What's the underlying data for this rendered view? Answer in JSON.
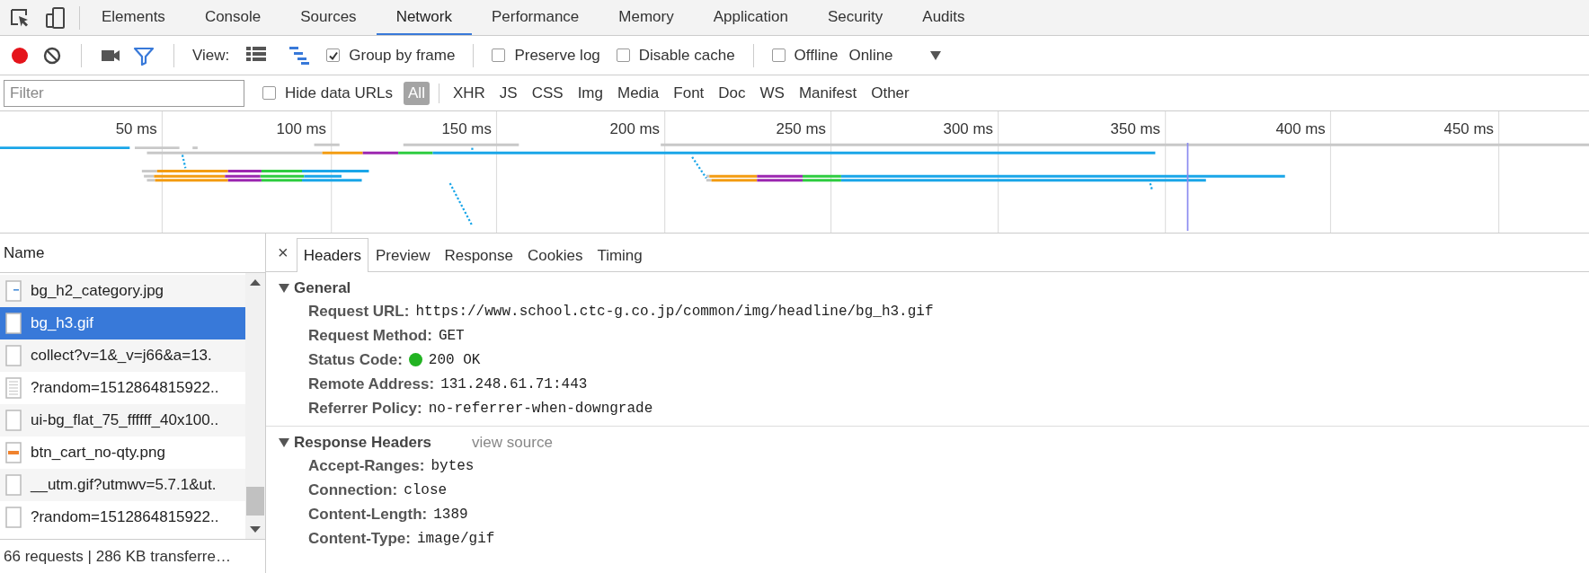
{
  "main_tabs": [
    {
      "label": "Elements",
      "selected": false
    },
    {
      "label": "Console",
      "selected": false
    },
    {
      "label": "Sources",
      "selected": false
    },
    {
      "label": "Network",
      "selected": true
    },
    {
      "label": "Performance",
      "selected": false
    },
    {
      "label": "Memory",
      "selected": false
    },
    {
      "label": "Application",
      "selected": false
    },
    {
      "label": "Security",
      "selected": false
    },
    {
      "label": "Audits",
      "selected": false
    }
  ],
  "toolbar": {
    "record_on": true,
    "filter_active": true,
    "view_label": "View:",
    "view_modes": [
      {
        "kind": "list",
        "selected": false
      },
      {
        "kind": "waterfall",
        "selected": true
      }
    ],
    "checkbox_groups": [
      [
        {
          "label": "Group by frame",
          "checked": true
        }
      ],
      [
        {
          "label": "Preserve log",
          "checked": false
        },
        {
          "label": "Disable cache",
          "checked": false
        }
      ],
      [
        {
          "label": "Offline",
          "checked": false
        }
      ]
    ],
    "throttling": "Online"
  },
  "filter_bar": {
    "placeholder": "Filter",
    "hide_data_urls": {
      "label": "Hide data URLs",
      "checked": false
    },
    "types": [
      {
        "label": "All",
        "selected": true
      },
      {
        "label": "XHR",
        "selected": false
      },
      {
        "label": "JS",
        "selected": false
      },
      {
        "label": "CSS",
        "selected": false
      },
      {
        "label": "Img",
        "selected": false
      },
      {
        "label": "Media",
        "selected": false
      },
      {
        "label": "Font",
        "selected": false
      },
      {
        "label": "Doc",
        "selected": false
      },
      {
        "label": "WS",
        "selected": false
      },
      {
        "label": "Manifest",
        "selected": false
      },
      {
        "label": "Other",
        "selected": false
      }
    ]
  },
  "overview": {
    "ticks": [
      "50 ms",
      "100 ms",
      "150 ms",
      "200 ms",
      "250 ms",
      "300 ms",
      "350 ms",
      "400 ms",
      "450 ms"
    ]
  },
  "requests": {
    "column": "Name",
    "rows": [
      {
        "name": "bg_h2_category.jpg",
        "kind": "image",
        "color": "#4a8fd8",
        "selected": false
      },
      {
        "name": "bg_h3.gif",
        "kind": "blank",
        "selected": true
      },
      {
        "name": "collect?v=1&_v=j66&a=13.",
        "kind": "blank",
        "selected": false
      },
      {
        "name": "?random=1512864815922..",
        "kind": "document",
        "selected": false
      },
      {
        "name": "ui-bg_flat_75_ffffff_40x100..",
        "kind": "blank",
        "selected": false
      },
      {
        "name": "btn_cart_no-qty.png",
        "kind": "image",
        "color": "#f0822d",
        "selected": false
      },
      {
        "name": "__utm.gif?utmwv=5.7.1&ut.",
        "kind": "blank",
        "selected": false
      },
      {
        "name": "?random=1512864815922..",
        "kind": "blank",
        "selected": false
      }
    ],
    "summary": "66 requests | 286 KB transferre…"
  },
  "details": {
    "close": "×",
    "tabs": [
      {
        "label": "Headers",
        "selected": true
      },
      {
        "label": "Preview",
        "selected": false
      },
      {
        "label": "Response",
        "selected": false
      },
      {
        "label": "Cookies",
        "selected": false
      },
      {
        "label": "Timing",
        "selected": false
      }
    ],
    "sections": [
      {
        "title": "General",
        "expanded": true,
        "fields": [
          {
            "name": "Request URL:",
            "value": "https://www.school.ctc-g.co.jp/common/img/headline/bg_h3.gif"
          },
          {
            "name": "Request Method:",
            "value": "GET"
          },
          {
            "name": "Status Code:",
            "value": "200 OK",
            "color": "#22b322"
          },
          {
            "name": "Remote Address:",
            "value": "131.248.61.71:443"
          },
          {
            "name": "Referrer Policy:",
            "value": "no-referrer-when-downgrade"
          }
        ]
      },
      {
        "title": "Response Headers",
        "expanded": true,
        "link": "view source",
        "fields": [
          {
            "name": "Accept-Ranges:",
            "value": "bytes"
          },
          {
            "name": "Connection:",
            "value": "close"
          },
          {
            "name": "Content-Length:",
            "value": "1389"
          },
          {
            "name": "Content-Type:",
            "value": "image/gif"
          }
        ]
      }
    ]
  }
}
